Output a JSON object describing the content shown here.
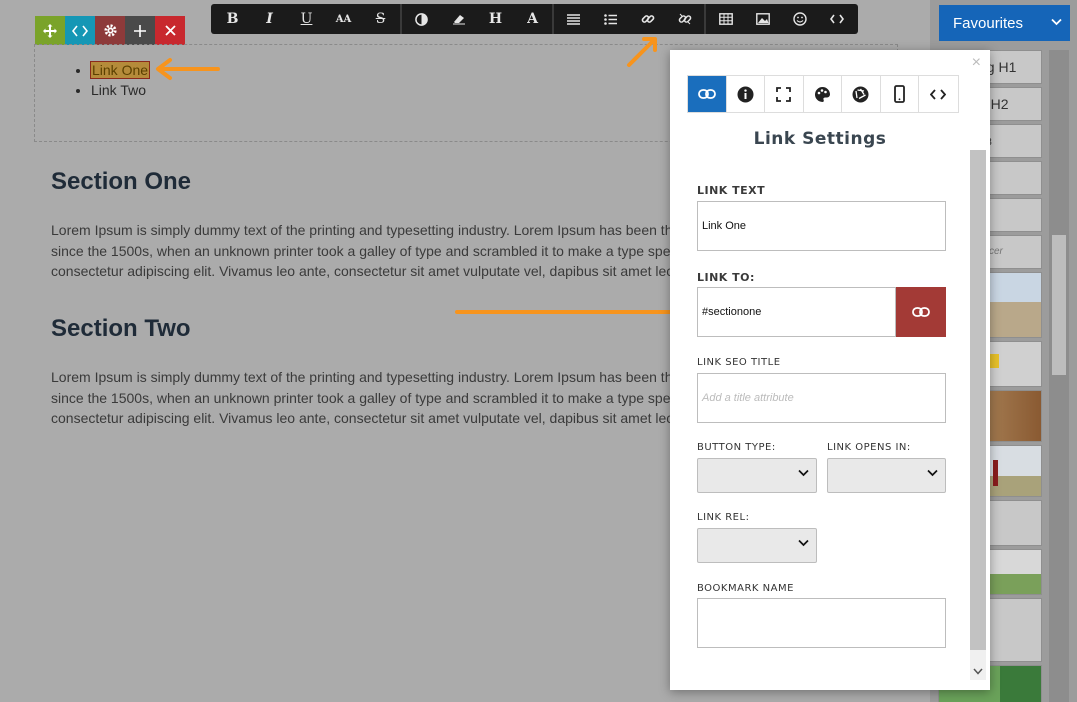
{
  "format_toolbar": {
    "bold": "B",
    "italic": "I",
    "underline": "U",
    "font_size": "AA",
    "strikethrough": "S",
    "heading": "H",
    "font": "A"
  },
  "content": {
    "list_items": [
      "Link One",
      "Link Two"
    ],
    "sections": [
      {
        "heading": "Section One",
        "text": "Lorem Ipsum is simply dummy text of the printing and typesetting industry. Lorem Ipsum has been the indu\nsince the 1500s, when an unknown printer took a galley of type and scrambled it to make a type specimen\nconsectetur adipiscing elit. Vivamus leo ante, consectetur sit amet vulputate vel, dapibus sit amet lectus."
      },
      {
        "heading": "Section Two",
        "text": "Lorem Ipsum is simply dummy text of the printing and typesetting industry. Lorem Ipsum has been the indu\nsince the 1500s, when an unknown printer took a galley of type and scrambled it to make a type specimen\nconsectetur adipiscing elit. Vivamus leo ante, consectetur sit amet vulputate vel, dapibus sit amet lectus."
      }
    ]
  },
  "sidebar": {
    "dropdown_label": "Favourites",
    "thumb_labels": [
      "ng H1",
      "g H2",
      "H3",
      "cer"
    ]
  },
  "modal": {
    "title": "Link Settings",
    "close": "×",
    "link_text_label": "LINK TEXT",
    "link_text_value": "Link One",
    "link_to_label": "LINK TO:",
    "link_to_value": "#sectionone",
    "seo_title_label": "LINK SEO TITLE",
    "seo_title_placeholder": "Add a title attribute",
    "button_type_label": "BUTTON TYPE:",
    "opens_in_label": "LINK OPENS IN:",
    "rel_label": "LINK REL:",
    "bookmark_label": "BOOKMARK NAME",
    "bookmark_value": ""
  },
  "colors": {
    "accent_blue": "#1a6ebd",
    "link_button": "#a33a36",
    "annotation_arrow": "#f7941d"
  }
}
